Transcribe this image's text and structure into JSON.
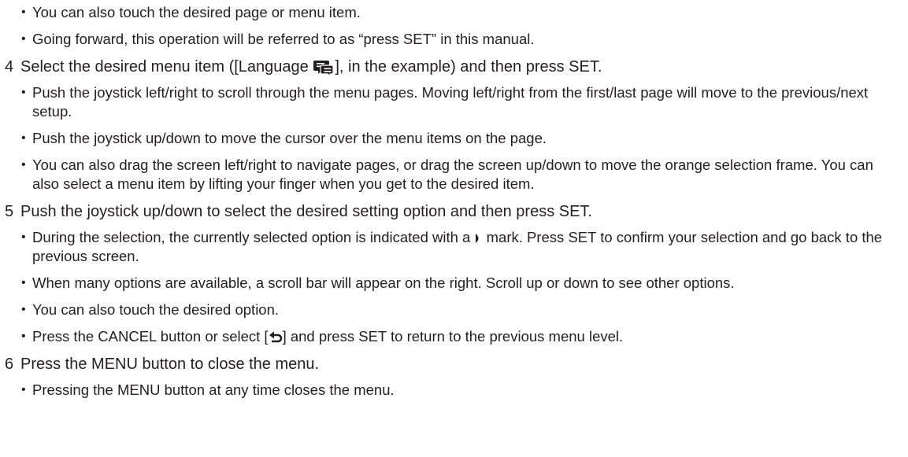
{
  "intro_bullets": [
    "You can also touch the desired page or menu item.",
    "Going forward, this operation will be referred to as “press SET” in this manual."
  ],
  "step4": {
    "number": "4",
    "text_before": "Select the desired menu item ([Language ",
    "icon": "language-icon",
    "text_after": "], in the example) and then press SET.",
    "bullets": [
      "Push the joystick left/right to scroll through the menu pages. Moving left/right from the first/last page will move to the previous/next setup.",
      "Push the joystick up/down to move the cursor over the menu items on the page.",
      "You can also drag the screen left/right to navigate pages, or drag the screen up/down to move the orange selection frame. You can also select a menu item by lifting your finger when you get to the desired item."
    ]
  },
  "step5": {
    "number": "5",
    "text": "Push the joystick up/down to select the desired setting option and then press SET.",
    "bullet1_before": "During the selection, the currently selected option is indicated with a ",
    "bullet1_icon": "selection-mark-icon",
    "bullet1_after": " mark. Press SET to confirm your selection and go back to the previous screen.",
    "bullet2": "When many options are available, a scroll bar will appear on the right. Scroll up or down to see other options.",
    "bullet3": "You can also touch the desired option.",
    "bullet4_before": "Press the CANCEL button or select [",
    "bullet4_icon": "return-icon",
    "bullet4_after": "] and press SET to return to the previous menu level."
  },
  "step6": {
    "number": "6",
    "text": "Press the MENU button to close the menu.",
    "bullets": [
      "Pressing the MENU button at any time closes the menu."
    ]
  }
}
